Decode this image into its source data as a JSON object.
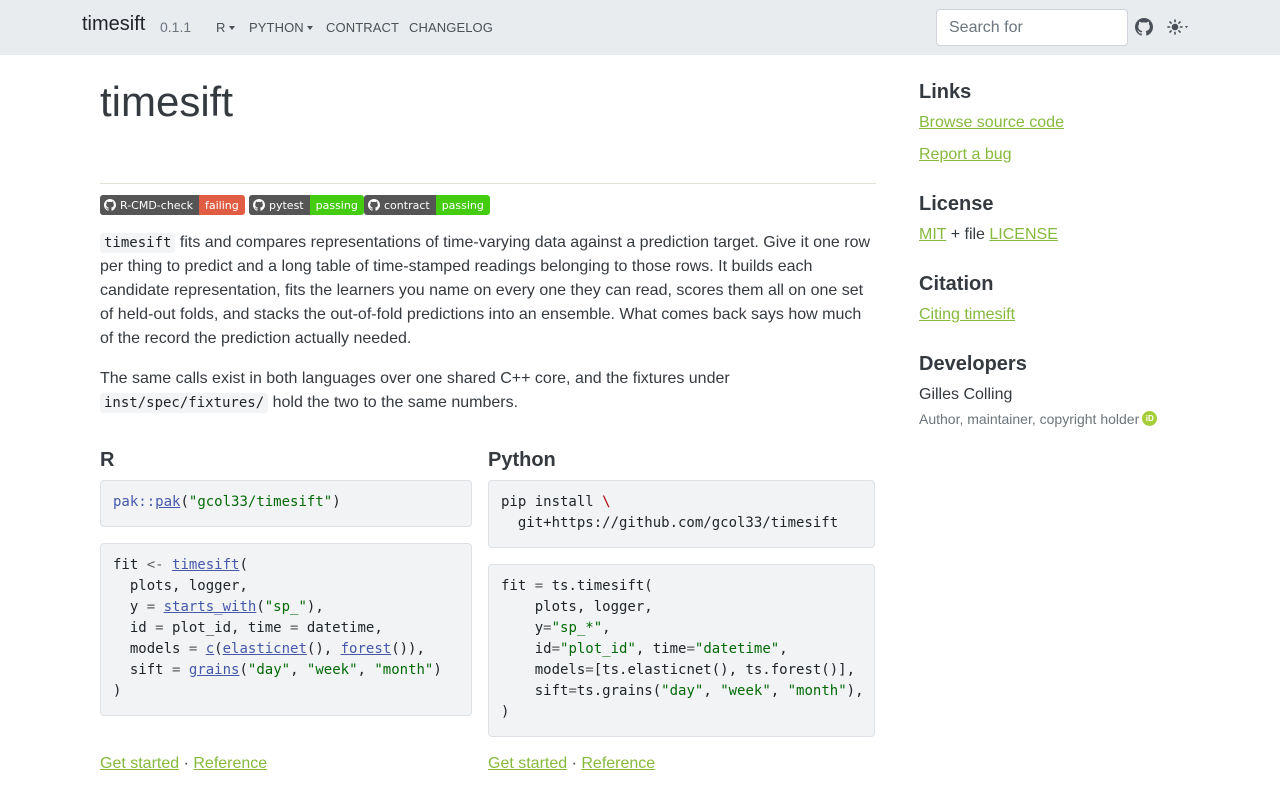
{
  "navbar": {
    "brand": "timesift",
    "version": "0.1.1",
    "items": [
      {
        "label": "R",
        "dropdown": true
      },
      {
        "label": "PYTHON",
        "dropdown": true
      },
      {
        "label": "CONTRACT",
        "dropdown": false
      },
      {
        "label": "CHANGELOG",
        "dropdown": false
      }
    ],
    "search_placeholder": "Search for",
    "icons": [
      "github-icon",
      "theme-toggle-icon"
    ]
  },
  "main": {
    "title": "timesift",
    "badges": [
      {
        "name": "R-CMD-check",
        "status": "failing",
        "color": "#e05d44"
      },
      {
        "name": "pytest",
        "status": "passing",
        "color": "#44cc11"
      },
      {
        "name": "contract",
        "status": "passing",
        "color": "#44cc11"
      }
    ],
    "intro_code": "timesift",
    "intro_text": " fits and compares representations of time-varying data against a prediction target. Give it one row per thing to predict and a long table of time-stamped readings belonging to those rows. It builds each candidate representation, fits the learners you name on every one they can read, scores them all on one set of held-out folds, and stacks the out-of-fold predictions into an ensemble. What comes back says how much of the record the prediction actually needed.",
    "second_text_a": "The same calls exist in both languages over one shared C++ core, and the fixtures under ",
    "second_code": "inst/spec/fixtures/",
    "second_text_b": " hold the two to the same numbers.",
    "r": {
      "heading": "R",
      "install": "pak::pak(\"gcol33/timesift\")",
      "example": "fit <- timesift(\n  plots, logger,\n  y = starts_with(\"sp_\"),\n  id = plot_id, time = datetime,\n  models = c(elasticnet(), forest()),\n  sift = grains(\"day\", \"week\", \"month\")\n)",
      "links": {
        "get_started": "Get started",
        "sep": " · ",
        "reference": "Reference"
      }
    },
    "python": {
      "heading": "Python",
      "install": "pip install \\\n  git+https://github.com/gcol33/timesift",
      "example": "fit = ts.timesift(\n    plots, logger,\n    y=\"sp_*\",\n    id=\"plot_id\", time=\"datetime\",\n    models=[ts.elasticnet(), ts.forest()],\n    sift=ts.grains(\"day\", \"week\", \"month\"),\n)",
      "links": {
        "get_started": "Get started",
        "sep": " · ",
        "reference": "Reference"
      }
    }
  },
  "sidebar": {
    "links_heading": "Links",
    "links": [
      "Browse source code",
      "Report a bug"
    ],
    "license_heading": "License",
    "license_mit": "MIT",
    "license_mid": " + file ",
    "license_file": "LICENSE",
    "citation_heading": "Citation",
    "citation_link": "Citing timesift",
    "developers_heading": "Developers",
    "developer_name": "Gilles Colling",
    "developer_role": "Author, maintainer, copyright holder",
    "orcid_label": "iD"
  },
  "colors": {
    "navbar_bg": "#e9ecef",
    "link": "#86b93d",
    "badge_fail": "#e05d44",
    "badge_pass": "#44cc11"
  }
}
